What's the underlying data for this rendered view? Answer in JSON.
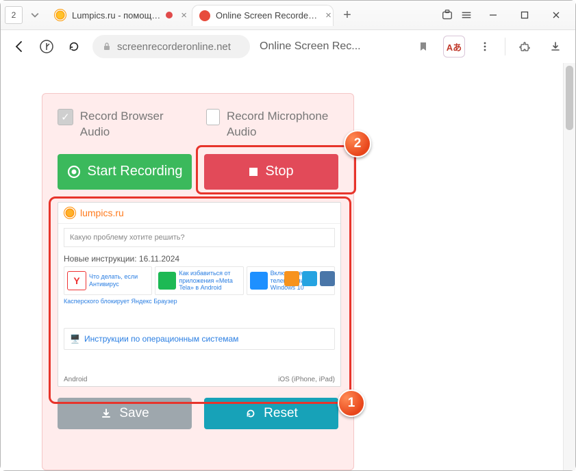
{
  "titlebar": {
    "tab_count": "2",
    "tabs": [
      {
        "label": "Lumpics.ru - помощ…",
        "has_rec": true
      },
      {
        "label": "Online Screen Recorde…"
      }
    ]
  },
  "addr": {
    "domain": "screenrecorderonline.net",
    "page_title": "Online Screen Rec...",
    "translate_label": "Aあ"
  },
  "options": {
    "browser_audio": "Record Browser Audio",
    "mic_audio": "Record Microphone Audio"
  },
  "buttons": {
    "start": "Start Recording",
    "stop": "Stop",
    "save": "Save",
    "reset": "Reset"
  },
  "badge1": "1",
  "badge2": "2",
  "preview": {
    "site": "lumpics.ru",
    "search_placeholder": "Какую проблему хотите решить?",
    "section": "Новые инструкции: 16.11.2024",
    "card1": "Что делать, если Антивирус",
    "card1b": "Касперского блокирует Яндекс Браузер",
    "card2": "Как избавиться от приложения «Meta Tela» в Android",
    "card3": "Включение телеметрии в Windows 10",
    "link": "Инструкции по операционным системам",
    "foot_left": "Android",
    "foot_right": "iOS (iPhone, iPad)"
  }
}
